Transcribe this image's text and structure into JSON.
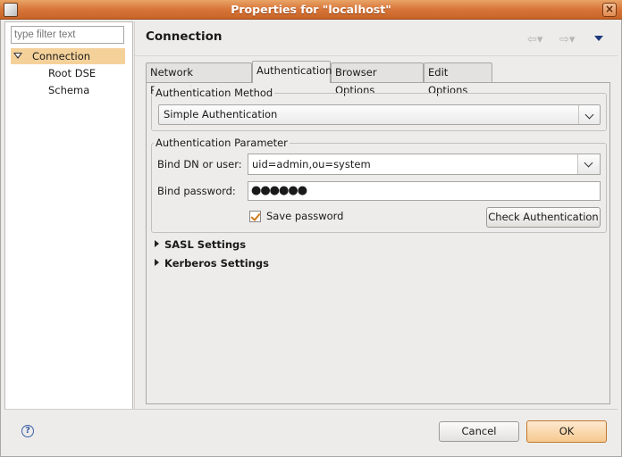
{
  "window": {
    "title": "Properties for \"localhost\""
  },
  "sidebar": {
    "filter_placeholder": "type filter text",
    "items": [
      {
        "label": "Connection",
        "selected": true
      },
      {
        "label": "Root DSE"
      },
      {
        "label": "Schema"
      }
    ]
  },
  "header": {
    "title": "Connection",
    "back_icon": "arrow-left-icon",
    "forward_icon": "arrow-right-icon",
    "menu_icon": "view-menu-icon"
  },
  "tabs": [
    {
      "label": "Network Parameter"
    },
    {
      "label": "Authentication",
      "active": true
    },
    {
      "label": "Browser Options"
    },
    {
      "label": "Edit Options"
    }
  ],
  "auth_method": {
    "group_title": "Authentication Method",
    "selected": "Simple Authentication"
  },
  "auth_param": {
    "group_title": "Authentication Parameter",
    "bind_dn_label": "Bind DN or user:",
    "bind_dn_value": "uid=admin,ou=system",
    "bind_pw_label": "Bind password:",
    "bind_pw_value": "●●●●●●",
    "save_password_label": "Save password",
    "save_password_checked": true,
    "check_button": "Check Authentication"
  },
  "sections": {
    "sasl": "SASL Settings",
    "kerberos": "Kerberos Settings"
  },
  "footer": {
    "cancel": "Cancel",
    "ok": "OK",
    "help_icon": "help-icon"
  },
  "colors": {
    "titlebar": "#d7753a",
    "selection": "#f5d19a",
    "ok_button": "#f6c98f"
  }
}
